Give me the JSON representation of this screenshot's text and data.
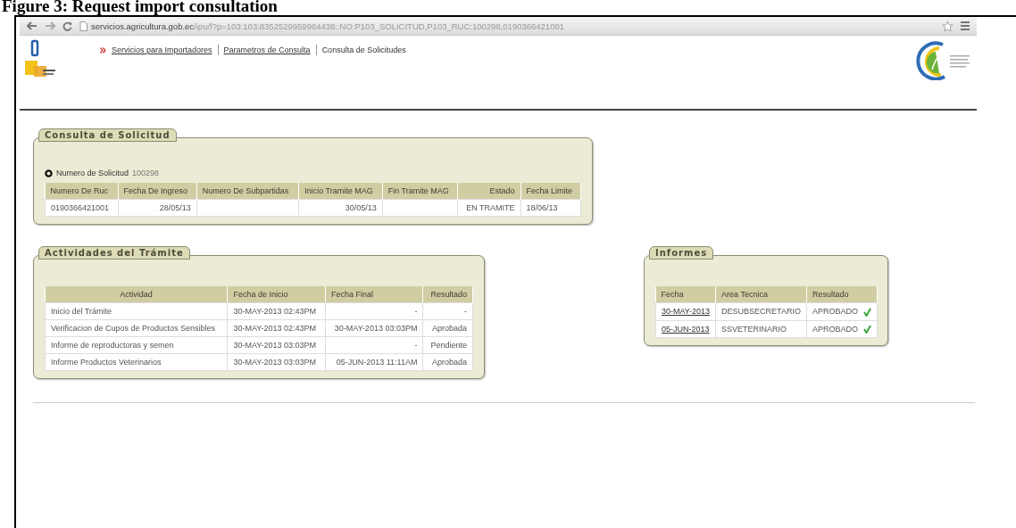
{
  "caption": "Figure 3: Request import consultation",
  "browser": {
    "url": "servicios.agricultura.gob.ec/ipu/f?p=103:103:8352529959984438::NO:P103_SOLICITUD,P103_RUC:100298,0190366421001"
  },
  "breadcrumb": [
    {
      "label": "Servicios para Importadores",
      "link": true
    },
    {
      "label": "Parametros de Consulta",
      "link": true
    },
    {
      "label": "Consulta de Solicitudes",
      "link": false
    }
  ],
  "solicitud": {
    "title": "Consulta de Solicitud",
    "number_label": "Numero de Solicitud",
    "number": "100298",
    "columns": [
      "Numero De Ruc",
      "Fecha De Ingreso",
      "Numero De Subpartidas",
      "Inicio Tramite MAG",
      "Fin Tramite MAG",
      "Estado",
      "Fecha Limite"
    ],
    "rows": [
      [
        "0190366421001",
        "28/05/13",
        "",
        "30/05/13",
        "",
        "EN TRAMITE",
        "18/06/13"
      ]
    ]
  },
  "actividades": {
    "title": "Actividades del Trámite",
    "columns": [
      "Actividad",
      "Fecha de Inicio",
      "Fecha Final",
      "Resultado"
    ],
    "rows": [
      [
        "Inicio del Trámite",
        "30-MAY-2013 02:43PM",
        "-",
        "-"
      ],
      [
        "Verificacion de Cupos de Productos Sensibles",
        "30-MAY-2013 02:43PM",
        "30-MAY-2013 03:03PM",
        "Aprobada"
      ],
      [
        "Informe de reproductoras y semen",
        "30-MAY-2013 03:03PM",
        "-",
        "Pendiente"
      ],
      [
        "Informe Productos Veterinarios",
        "30-MAY-2013 03:03PM",
        "05-JUN-2013 11:11AM",
        "Aprobada"
      ]
    ]
  },
  "informes": {
    "title": "Informes",
    "columns": [
      "Fecha",
      "Area Tecnica",
      "Resultado"
    ],
    "rows": [
      {
        "fecha": "30-MAY-2013",
        "area": "DESUBSECRETARIO",
        "resultado": "APROBADO",
        "approved": true
      },
      {
        "fecha": "05-JUN-2013",
        "area": "SSVETERINARIO",
        "resultado": "APROBADO",
        "approved": true
      }
    ]
  }
}
